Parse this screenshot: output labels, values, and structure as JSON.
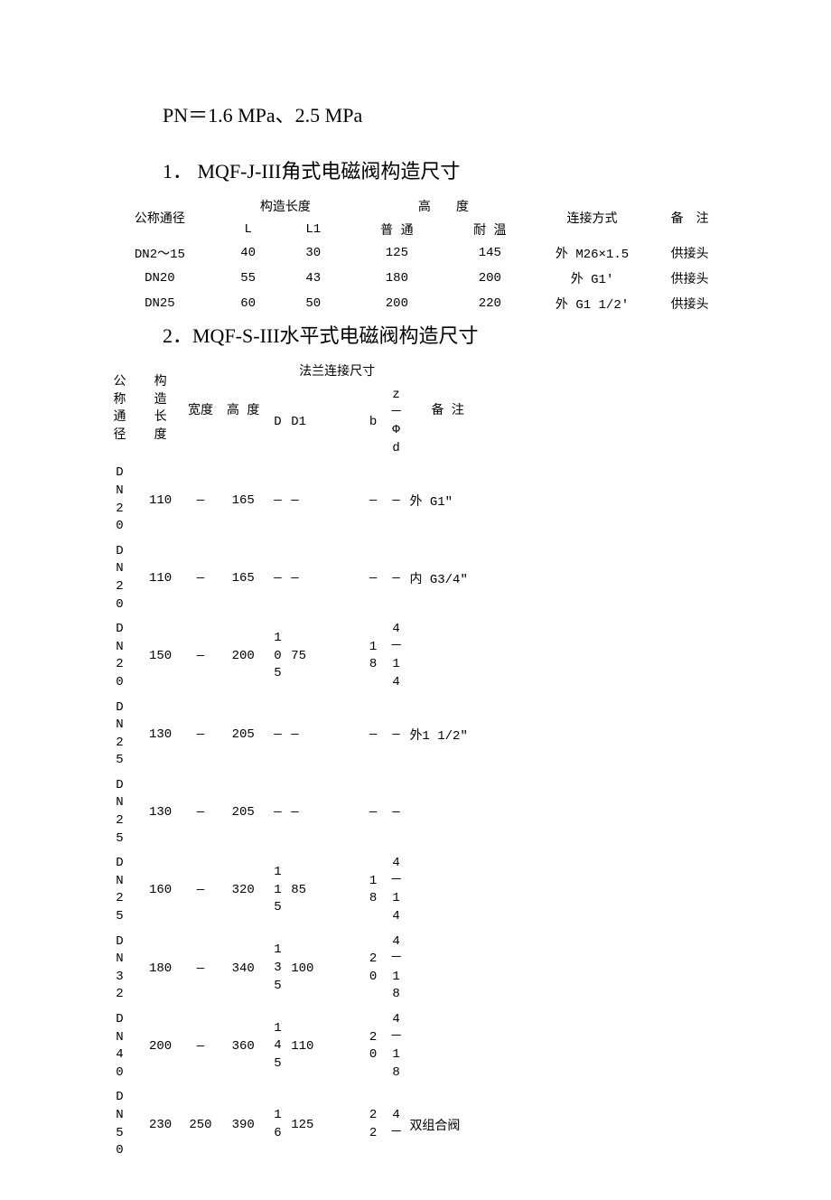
{
  "pn_line": "PN＝1.6 MPa、2.5 MPa",
  "section1": {
    "title": "1．  MQF-J-III角式电磁阀构造尺寸",
    "headers": {
      "nominal": "公称通径",
      "length_group": "构造长度",
      "L": "L",
      "L1": "L1",
      "height_group": "高　　度",
      "normal": "普 通",
      "heat": "耐 温",
      "connect": "连接方式",
      "remark": "备　注"
    },
    "rows": [
      {
        "dn": "DN2～15",
        "L": "40",
        "L1": "30",
        "normal": "125",
        "heat": "145",
        "conn": "外 M26×1.5",
        "rem": "供接头"
      },
      {
        "dn": "DN20",
        "L": "55",
        "L1": "43",
        "normal": "180",
        "heat": "200",
        "conn": "外 G1'",
        "rem": "供接头"
      },
      {
        "dn": "DN25",
        "L": "60",
        "L1": "50",
        "normal": "200",
        "heat": "220",
        "conn": "外 G1 1/2'",
        "rem": "供接头"
      }
    ]
  },
  "section2": {
    "title": "2．MQF-S-III水平式电磁阀构造尺寸",
    "headers": {
      "nominal": "公称通径",
      "length": "构造长度",
      "width": "宽度",
      "height": "高 度",
      "flange_group": "法兰连接尺寸",
      "D": "D",
      "D1": "D1",
      "b": "b",
      "zphid": "z－Φd",
      "remark": "备 注"
    },
    "rows": [
      {
        "dn": "DN20",
        "len": "110",
        "w": "—",
        "h": "165",
        "D": "—",
        "D1": "—",
        "b": "—",
        "z": "—",
        "rem": "外 G1\""
      },
      {
        "dn": "DN20",
        "len": "110",
        "w": "—",
        "h": "165",
        "D": "—",
        "D1": "—",
        "b": "—",
        "z": "—",
        "rem": "内 G3/4\""
      },
      {
        "dn": "DN20",
        "len": "150",
        "w": "—",
        "h": "200",
        "D": "105",
        "D1": "75",
        "b": "18",
        "z": "4－14",
        "rem": ""
      },
      {
        "dn": "DN25",
        "len": "130",
        "w": "—",
        "h": "205",
        "D": "—",
        "D1": "—",
        "b": "—",
        "z": "—",
        "rem": "外1 1/2\""
      },
      {
        "dn": "DN25",
        "len": "130",
        "w": "—",
        "h": "205",
        "D": "—",
        "D1": "—",
        "b": "—",
        "z": "—",
        "rem": ""
      },
      {
        "dn": "DN25",
        "len": "160",
        "w": "—",
        "h": "320",
        "D": "115",
        "D1": "85",
        "b": "18",
        "z": "4－14",
        "rem": ""
      },
      {
        "dn": "DN32",
        "len": "180",
        "w": "—",
        "h": "340",
        "D": "135",
        "D1": "100",
        "b": "20",
        "z": "4－18",
        "rem": ""
      },
      {
        "dn": "DN40",
        "len": "200",
        "w": "—",
        "h": "360",
        "D": "145",
        "D1": "110",
        "b": "20",
        "z": "4－18",
        "rem": ""
      },
      {
        "dn": "DN50",
        "len": "230",
        "w": "250",
        "h": "390",
        "D": "16",
        "D1": "125",
        "b": "22",
        "z": "4－",
        "rem": "双组合阀"
      }
    ]
  }
}
